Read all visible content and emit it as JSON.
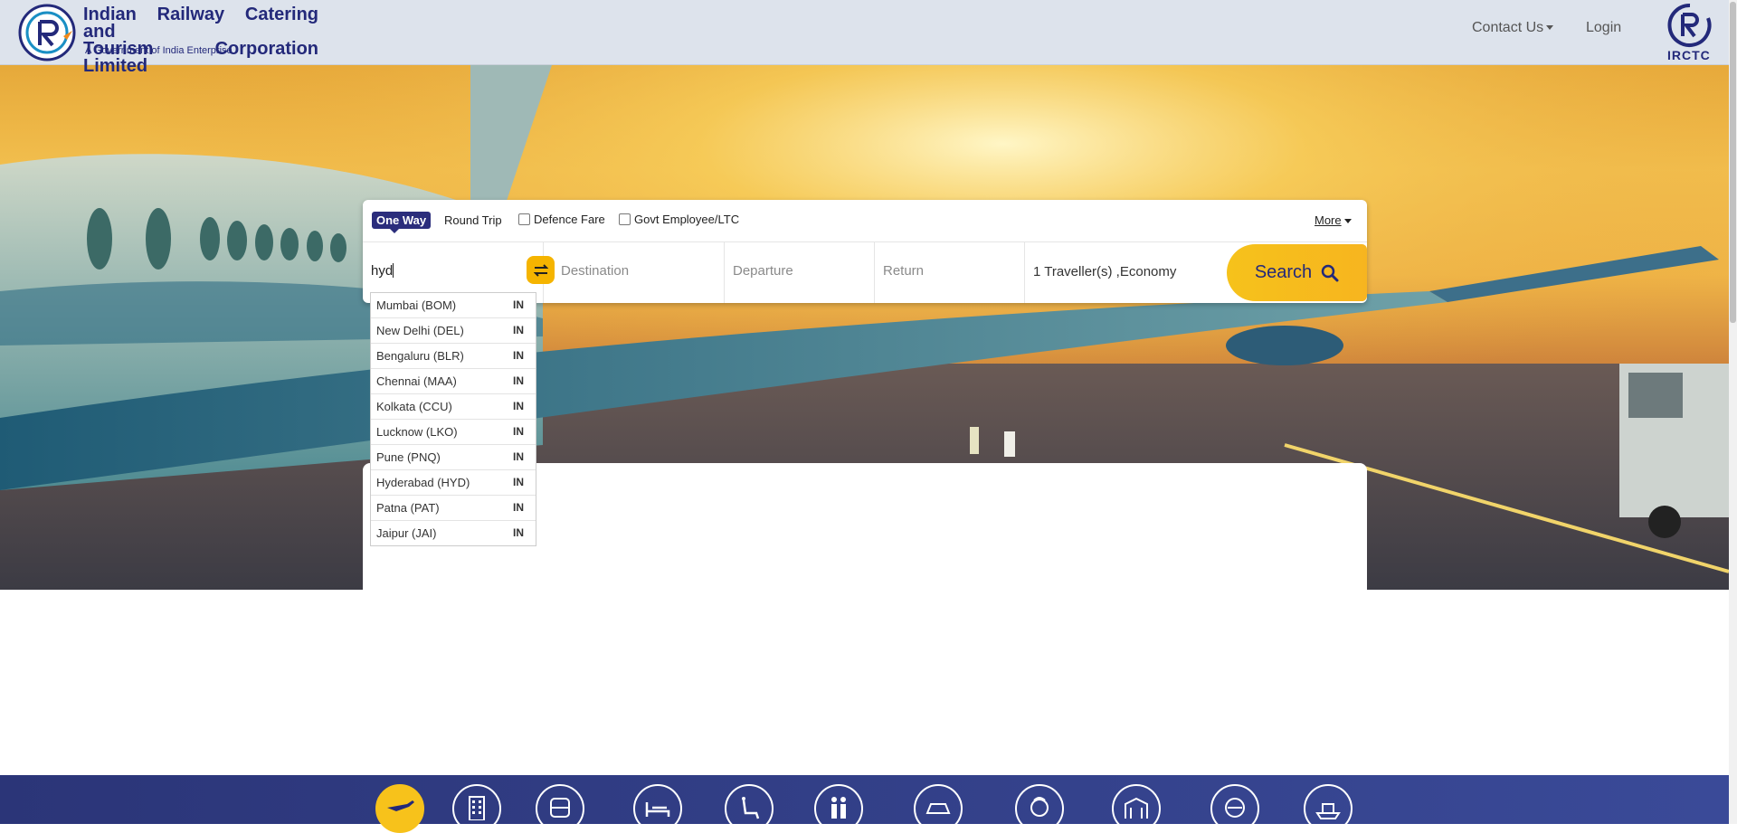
{
  "header": {
    "org_name_line1": "Indian Railway Catering and",
    "org_name_line2": "Tourism Corporation Limited",
    "org_sub": "A Government of India Enterprise",
    "nav": {
      "contact": "Contact Us",
      "login": "Login"
    },
    "brand": "IRCTC"
  },
  "search": {
    "trip_types": {
      "one_way": "One Way",
      "round_trip": "Round Trip"
    },
    "options": {
      "defence": "Defence Fare",
      "govt": "Govt Employee/LTC",
      "more": "More"
    },
    "from_value": "hyd",
    "destination_placeholder": "Destination",
    "departure_placeholder": "Departure",
    "return_placeholder": "Return",
    "travellers": "1 Traveller(s) ,Economy",
    "search_label": "Search"
  },
  "suggestions": [
    {
      "name": "Mumbai (BOM)",
      "code": "IN"
    },
    {
      "name": "New Delhi (DEL)",
      "code": "IN"
    },
    {
      "name": "Bengaluru (BLR)",
      "code": "IN"
    },
    {
      "name": "Chennai (MAA)",
      "code": "IN"
    },
    {
      "name": "Kolkata (CCU)",
      "code": "IN"
    },
    {
      "name": "Lucknow (LKO)",
      "code": "IN"
    },
    {
      "name": "Pune (PNQ)",
      "code": "IN"
    },
    {
      "name": "Hyderabad (HYD)",
      "code": "IN"
    },
    {
      "name": "Patna (PAT)",
      "code": "IN"
    },
    {
      "name": "Jaipur (JAI)",
      "code": "IN"
    }
  ],
  "services": [
    "flight-icon",
    "hotel-icon",
    "bus-icon",
    "bed-icon",
    "lounge-icon",
    "family-icon",
    "taxi-icon",
    "chef-icon",
    "temple-icon",
    "tour-icon",
    "cruise-icon"
  ],
  "colors": {
    "brand_navy": "#23297a",
    "accent_yellow": "#f6c21b",
    "header_bg": "#dde3ec"
  }
}
